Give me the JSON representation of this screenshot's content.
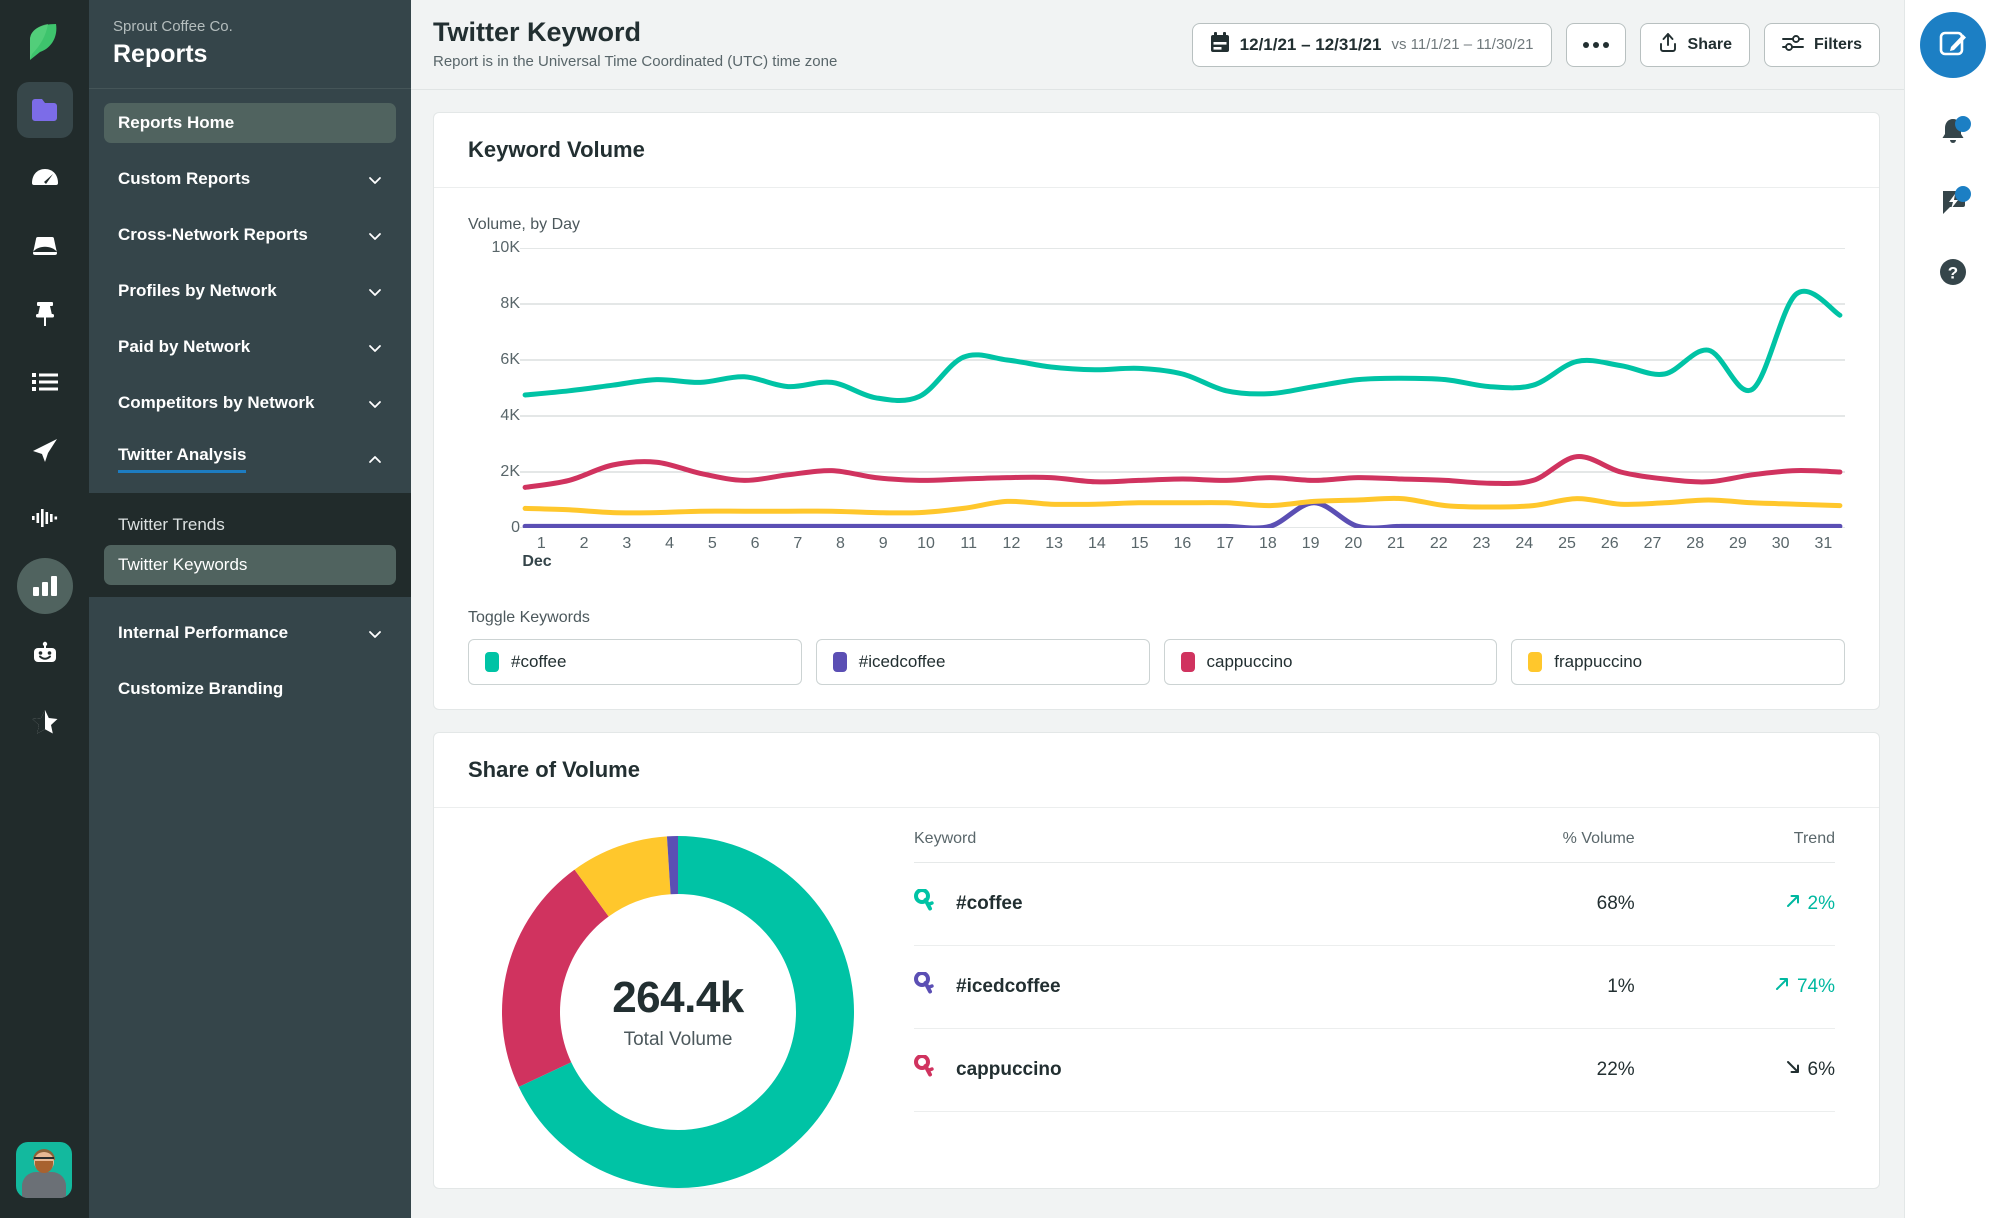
{
  "rail": {
    "logo_icon": "sprout-leaf-logo",
    "items": [
      {
        "name": "folder-icon",
        "state": "active-square"
      },
      {
        "name": "dashboard-speedometer-icon",
        "state": "idle"
      },
      {
        "name": "inbox-icon",
        "state": "idle"
      },
      {
        "name": "pin-icon",
        "state": "idle"
      },
      {
        "name": "list-icon",
        "state": "idle"
      },
      {
        "name": "publishing-send-icon",
        "state": "idle"
      },
      {
        "name": "listening-waveform-icon",
        "state": "idle"
      },
      {
        "name": "reports-bars-icon",
        "state": "active-circle"
      },
      {
        "name": "bot-icon",
        "state": "idle"
      },
      {
        "name": "star-half-icon",
        "state": "idle"
      }
    ],
    "avatar_alt": "user-avatar"
  },
  "sidebar": {
    "org": "Sprout Coffee Co.",
    "title": "Reports",
    "items": [
      {
        "label": "Reports Home",
        "selected": true,
        "chevron": null
      },
      {
        "label": "Custom Reports",
        "selected": false,
        "chevron": "down"
      },
      {
        "label": "Cross-Network Reports",
        "selected": false,
        "chevron": "down"
      },
      {
        "label": "Profiles by Network",
        "selected": false,
        "chevron": "down"
      },
      {
        "label": "Paid by Network",
        "selected": false,
        "chevron": "down"
      },
      {
        "label": "Competitors by Network",
        "selected": false,
        "chevron": "down"
      }
    ],
    "expanded_group": {
      "label": "Twitter Analysis",
      "chevron": "up"
    },
    "sub_items": [
      {
        "label": "Twitter Trends",
        "selected": false
      },
      {
        "label": "Twitter Keywords",
        "selected": true
      }
    ],
    "items_after": [
      {
        "label": "Internal Performance",
        "selected": false,
        "chevron": "down"
      },
      {
        "label": "Customize Branding",
        "selected": false,
        "chevron": null
      }
    ]
  },
  "header": {
    "title": "Twitter Keyword",
    "subtitle": "Report is in the Universal Time Coordinated (UTC) time zone",
    "date_range": "12/1/21 – 12/31/21",
    "date_compare": "vs 11/1/21 – 11/30/21",
    "more_label": "•••",
    "share_label": "Share",
    "filters_label": "Filters"
  },
  "right_rail": {
    "compose_icon": "compose-pencil-icon",
    "items": [
      {
        "name": "notifications-bell-icon",
        "badge": true
      },
      {
        "name": "whats-new-bolt-icon",
        "badge": true
      },
      {
        "name": "help-question-icon",
        "badge": false
      }
    ]
  },
  "keyword_volume": {
    "card_title": "Keyword Volume",
    "toggle_label": "Toggle Keywords",
    "chips": [
      {
        "label": "#coffee",
        "color": "#00C3A5"
      },
      {
        "label": "#icedcoffee",
        "color": "#5B4FB4"
      },
      {
        "label": "cappuccino",
        "color": "#D0335F"
      },
      {
        "label": "frappuccino",
        "color": "#FFC72C"
      }
    ]
  },
  "share_of_volume": {
    "card_title": "Share of Volume",
    "total_value": "264.4k",
    "total_label": "Total Volume",
    "columns": [
      "Keyword",
      "% Volume",
      "Trend"
    ],
    "rows": [
      {
        "keyword": "#coffee",
        "color": "#00C3A5",
        "volume": "68%",
        "trend_dir": "up",
        "trend": "2%"
      },
      {
        "keyword": "#icedcoffee",
        "color": "#5B4FB4",
        "volume": "1%",
        "trend_dir": "up",
        "trend": "74%"
      },
      {
        "keyword": "cappuccino",
        "color": "#D0335F",
        "volume": "22%",
        "trend_dir": "down",
        "trend": "6%"
      }
    ]
  },
  "chart_data": [
    {
      "type": "line",
      "title": "Keyword Volume",
      "subtitle": "Volume, by Day",
      "xlabel": "Dec",
      "ylabel": "",
      "ylim": [
        0,
        10000
      ],
      "yticks": [
        0,
        2000,
        4000,
        6000,
        8000,
        10000
      ],
      "ytick_labels": [
        "0",
        "2K",
        "4K",
        "6K",
        "8K",
        "10K"
      ],
      "grid": true,
      "legend_position": "bottom",
      "x": [
        1,
        2,
        3,
        4,
        5,
        6,
        7,
        8,
        9,
        10,
        11,
        12,
        13,
        14,
        15,
        16,
        17,
        18,
        19,
        20,
        21,
        22,
        23,
        24,
        25,
        26,
        27,
        28,
        29,
        30,
        31
      ],
      "categories": [
        "1",
        "2",
        "3",
        "4",
        "5",
        "6",
        "7",
        "8",
        "9",
        "10",
        "11",
        "12",
        "13",
        "14",
        "15",
        "16",
        "17",
        "18",
        "19",
        "20",
        "21",
        "22",
        "23",
        "24",
        "25",
        "26",
        "27",
        "28",
        "29",
        "30",
        "31"
      ],
      "series": [
        {
          "name": "#coffee",
          "color": "#00C3A5",
          "values": [
            4750,
            4900,
            5100,
            5300,
            5200,
            5400,
            5050,
            5200,
            4650,
            4700,
            6100,
            6000,
            5750,
            5650,
            5700,
            5500,
            4900,
            4800,
            5050,
            5300,
            5350,
            5300,
            5050,
            5100,
            5950,
            5800,
            5500,
            6350,
            4950,
            8350,
            7600
          ]
        },
        {
          "name": "cappuccino",
          "color": "#D0335F",
          "values": [
            1450,
            1700,
            2250,
            2350,
            1950,
            1700,
            1900,
            2050,
            1800,
            1700,
            1750,
            1800,
            1800,
            1650,
            1700,
            1750,
            1700,
            1800,
            1700,
            1800,
            1750,
            1700,
            1600,
            1700,
            2550,
            2000,
            1750,
            1650,
            1900,
            2050,
            2000
          ]
        },
        {
          "name": "frappuccino",
          "color": "#FFC72C",
          "values": [
            700,
            650,
            550,
            550,
            600,
            600,
            600,
            600,
            550,
            550,
            700,
            950,
            850,
            850,
            900,
            900,
            900,
            800,
            950,
            1000,
            1050,
            800,
            750,
            800,
            1050,
            850,
            900,
            1000,
            900,
            850,
            800
          ]
        },
        {
          "name": "#icedcoffee",
          "color": "#5B4FB4",
          "values": [
            60,
            60,
            60,
            60,
            60,
            60,
            60,
            60,
            60,
            60,
            60,
            60,
            60,
            60,
            60,
            60,
            60,
            60,
            900,
            60,
            60,
            60,
            60,
            60,
            60,
            60,
            60,
            60,
            60,
            60,
            60
          ]
        }
      ]
    },
    {
      "type": "pie",
      "title": "Share of Volume",
      "center_label": "264.4k",
      "center_sublabel": "Total Volume",
      "labels": [
        "#coffee",
        "cappuccino",
        "frappuccino",
        "#icedcoffee"
      ],
      "values": [
        68,
        22,
        9,
        1
      ],
      "colors": [
        "#00C3A5",
        "#D0335F",
        "#FFC72C",
        "#5B4FB4"
      ],
      "donut": true
    }
  ]
}
